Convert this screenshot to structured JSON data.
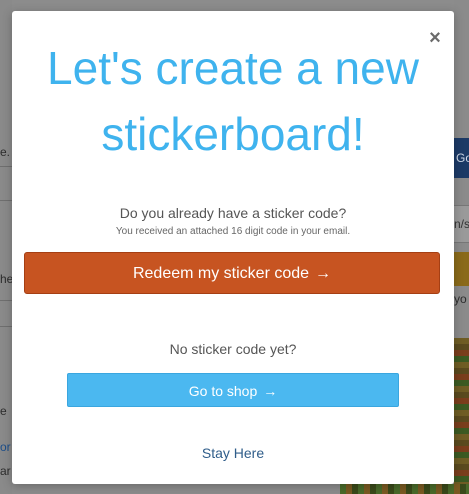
{
  "background": {
    "fragments": [
      "e.",
      "he",
      "e",
      "or",
      "ar"
    ],
    "right_button": "Go",
    "right_input": "n/s",
    "right_text": "yo"
  },
  "modal": {
    "close_symbol": "×",
    "title": "Let's create a new stickerboard!",
    "question": "Do you already have a sticker code?",
    "hint": "You received an attached 16 digit code in your email.",
    "redeem_label": "Redeem my sticker code",
    "redeem_arrow": "→",
    "no_code": "No sticker code yet?",
    "shop_label": "Go to shop",
    "shop_arrow": "→",
    "stay_label": "Stay Here"
  },
  "colors": {
    "title": "#3fb3ee",
    "redeem_button": "#c75421",
    "shop_button": "#4bb8f0",
    "stay_link": "#2f5d8a"
  }
}
